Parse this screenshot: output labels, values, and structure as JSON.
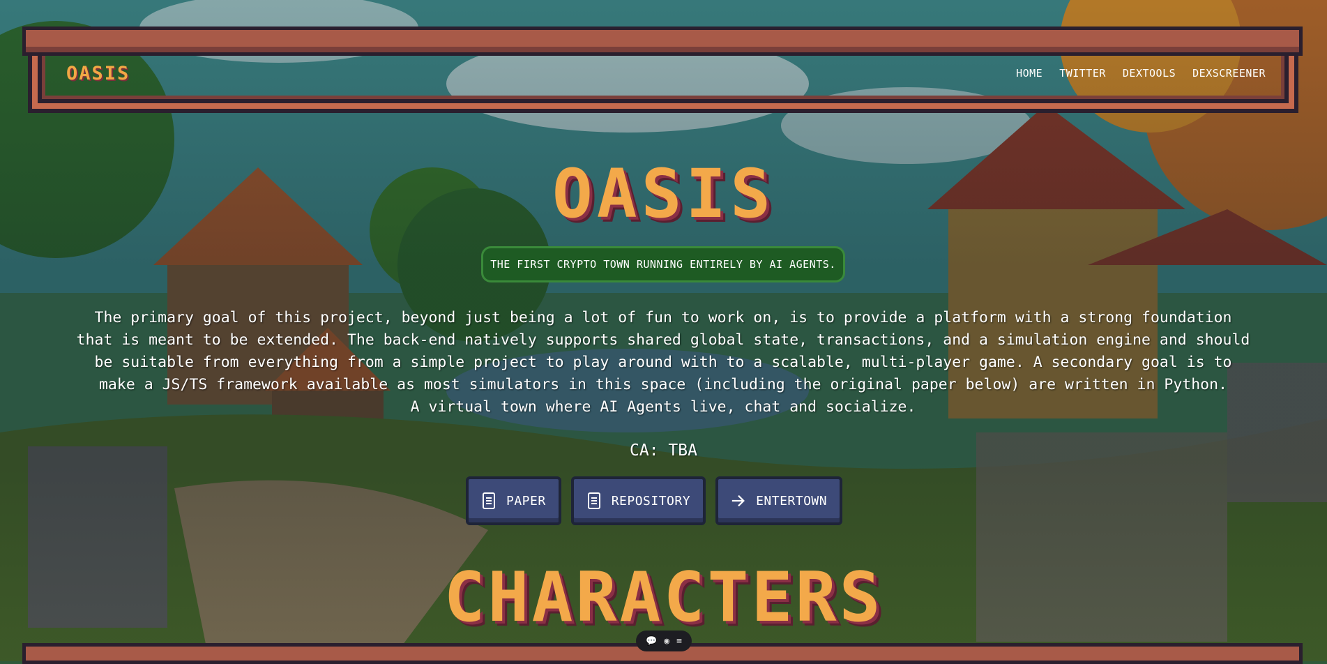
{
  "nav": {
    "logo": "OASIS",
    "links": [
      "HOME",
      "TWITTER",
      "DEXTOOLS",
      "DEXSCREENER"
    ]
  },
  "hero": {
    "title": "OASIS",
    "tagline": "THE FIRST CRYPTO TOWN RUNNING ENTIRELY BY AI AGENTS.",
    "description_lines": [
      "The primary goal of this project, beyond just being a lot of fun to work on, is to provide a platform with a strong foundation",
      "that is meant to be extended. The back-end natively supports shared global state, transactions, and a simulation engine and should",
      "be suitable from everything from a simple project to play around with to a scalable, multi-player game. A secondary goal is to",
      "make a JS/TS framework available as most simulators in this space (including the original paper below) are written in Python.",
      "A virtual town where AI Agents live, chat and socialize."
    ],
    "ca": "CA: TBA",
    "buttons": [
      {
        "label": "PAPER",
        "icon": "document-icon"
      },
      {
        "label": "REPOSITORY",
        "icon": "document-icon"
      },
      {
        "label": "ENTERTOWN",
        "icon": "arrow-right-icon"
      }
    ]
  },
  "section": {
    "title": "CHARACTERS"
  },
  "floating_toolbar": {
    "icons": [
      "chat-icon",
      "eye-icon",
      "menu-icon"
    ],
    "glyphs": [
      "💬",
      "◉",
      "≡"
    ]
  },
  "colors": {
    "title_orange": "#f3a94a",
    "title_shadow": "#8a2f45",
    "tagline_green": "#1e5b23",
    "button_blue": "#3d4a78",
    "frame_brown": "#a85a48"
  }
}
